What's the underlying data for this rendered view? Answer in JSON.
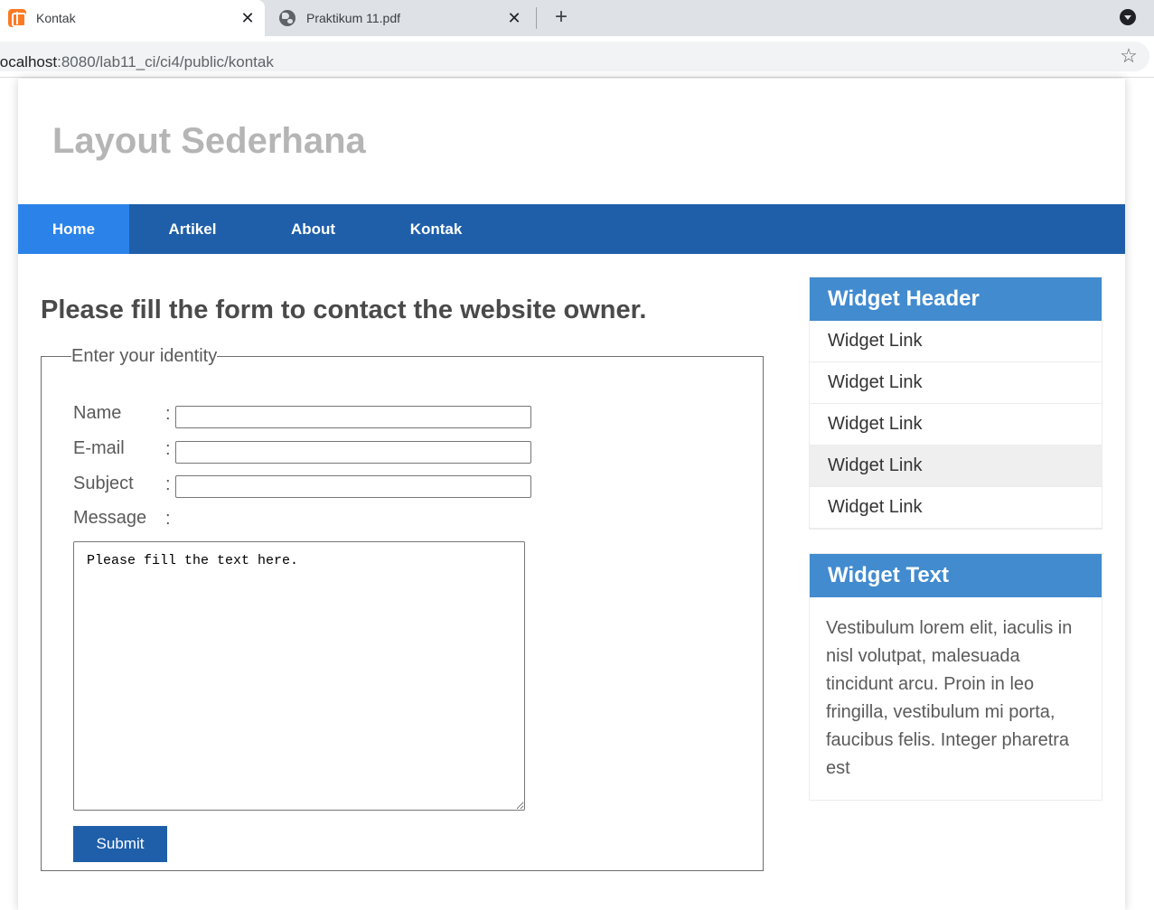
{
  "browser": {
    "tabs": [
      {
        "title": "Kontak",
        "active": true
      },
      {
        "title": "Praktikum 11.pdf",
        "active": false
      }
    ],
    "url_host": "localhost",
    "url_path": ":8080/lab11_ci/ci4/public/kontak"
  },
  "site": {
    "title": "Layout Sederhana",
    "nav": [
      "Home",
      "Artikel",
      "About",
      "Kontak"
    ]
  },
  "form": {
    "heading": "Please fill the form to contact the website owner.",
    "legend": "Enter your identity",
    "name_label": "Name",
    "email_label": "E-mail",
    "subject_label": "Subject",
    "message_label": "Message",
    "colon": ":",
    "message_placeholder": "Please fill the text here.",
    "submit_label": "Submit"
  },
  "sidebar": {
    "links_header": "Widget Header",
    "links": [
      "Widget Link",
      "Widget Link",
      "Widget Link",
      "Widget Link",
      "Widget Link"
    ],
    "text_header": "Widget Text",
    "text_body": "Vestibulum lorem elit, iaculis in nisl volutpat, malesuada tincidunt arcu. Proin in leo fringilla, vestibulum mi porta, faucibus felis. Integer pharetra est"
  },
  "colors": {
    "nav_bg": "#1f5faa",
    "nav_active": "#2b83ea",
    "widget_header": "#428bcf",
    "site_title": "#b5b5b5"
  }
}
